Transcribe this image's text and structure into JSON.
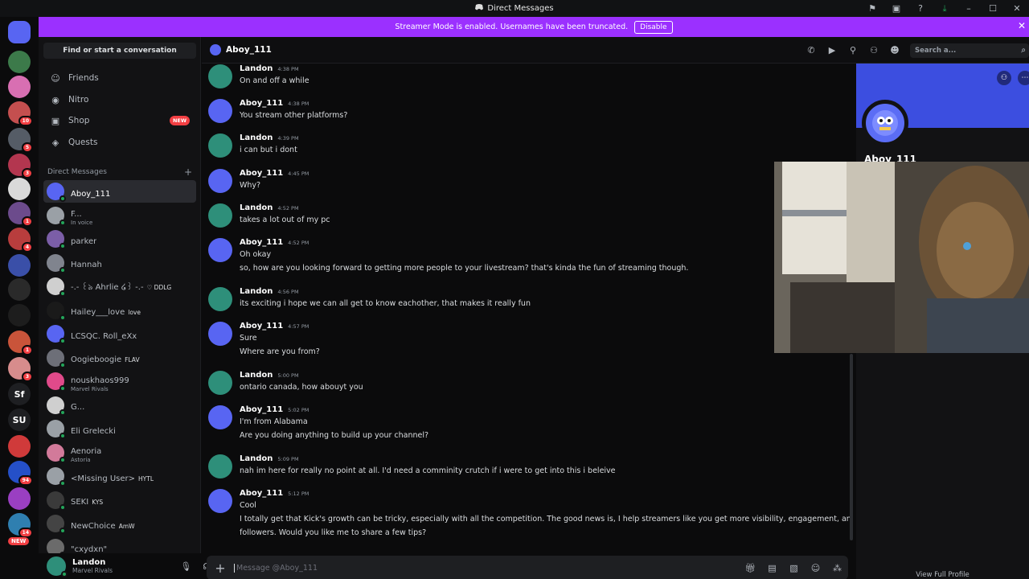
{
  "window": {
    "title": "Direct Messages"
  },
  "banner": {
    "text": "Streamer Mode is enabled. Usernames have been truncated.",
    "button": "Disable"
  },
  "servers": [
    {
      "label": "",
      "color": "#5865f2",
      "badge": ""
    },
    {
      "label": "",
      "color": "#3c7a4a",
      "badge": ""
    },
    {
      "label": "",
      "color": "#d86fb2",
      "badge": ""
    },
    {
      "label": "",
      "color": "#c44f4f",
      "badge": "10"
    },
    {
      "label": "",
      "color": "#555c66",
      "badge": "5"
    },
    {
      "label": "",
      "color": "#b3364f",
      "badge": "3"
    },
    {
      "label": "",
      "color": "#d9d9d9",
      "badge": ""
    },
    {
      "label": "",
      "color": "#6c4b8c",
      "badge": "1"
    },
    {
      "label": "",
      "color": "#b83d3d",
      "badge": "4"
    },
    {
      "label": "",
      "color": "#3a4fa8",
      "badge": ""
    },
    {
      "label": "",
      "color": "#2a2a2a",
      "badge": ""
    },
    {
      "label": "",
      "color": "#1d1d1d",
      "badge": ""
    },
    {
      "label": "",
      "color": "#c9543a",
      "badge": "1"
    },
    {
      "label": "",
      "color": "#d78c8c",
      "badge": "3"
    },
    {
      "label": "Sf",
      "color": "#1e1f22",
      "badge": ""
    },
    {
      "label": "SU",
      "color": "#1e1f22",
      "badge": ""
    },
    {
      "label": "",
      "color": "#d03a3a",
      "badge": ""
    },
    {
      "label": "",
      "color": "#2550c8",
      "badge": "94"
    },
    {
      "label": "",
      "color": "#9a3fc2",
      "badge": ""
    },
    {
      "label": "",
      "color": "#2f7fb0",
      "badge": "14"
    }
  ],
  "rail_new": "NEW",
  "dm_panel": {
    "find": "Find or start a conversation",
    "nav": [
      {
        "label": "Friends",
        "icon": "friends-icon"
      },
      {
        "label": "Nitro",
        "icon": "nitro-icon"
      },
      {
        "label": "Shop",
        "icon": "shop-icon",
        "badge": "NEW"
      },
      {
        "label": "Quests",
        "icon": "quests-icon"
      }
    ],
    "header": "Direct Messages",
    "items": [
      {
        "name": "Aboy_111",
        "sub": "",
        "tag": "",
        "color": "#5865f2",
        "active": true
      },
      {
        "name": "F...",
        "sub": "In voice",
        "tag": "",
        "color": "#9aa0a6",
        "active": false
      },
      {
        "name": "parker",
        "sub": "",
        "tag": "",
        "color": "#7b5ea7",
        "active": false
      },
      {
        "name": "Hannah",
        "sub": "",
        "tag": "",
        "color": "#80848e",
        "active": false
      },
      {
        "name": "-.- ꒰ঌ Ahrlie ໒꒱ -.-",
        "sub": "",
        "tag": "♡ DDLG",
        "color": "#cfcfcf",
        "active": false
      },
      {
        "name": "Hailey___love",
        "sub": "",
        "tag": "love",
        "color": "#1a1a1a",
        "active": false
      },
      {
        "name": "LCSQC. Roll_eXx",
        "sub": "",
        "tag": "",
        "color": "#5865f2",
        "active": false
      },
      {
        "name": "Oogieboogie",
        "sub": "",
        "tag": "FLAV",
        "color": "#6d6f78",
        "active": false
      },
      {
        "name": "nouskhaos999",
        "sub": "Marvel Rivals",
        "tag": "",
        "color": "#e04a8a",
        "active": false
      },
      {
        "name": "G...",
        "sub": "",
        "tag": "",
        "color": "#cfcfcf",
        "active": false
      },
      {
        "name": "Eli Grelecki",
        "sub": "",
        "tag": "",
        "color": "#9aa0a6",
        "active": false
      },
      {
        "name": "Aenoria",
        "sub": "Astoria",
        "tag": "",
        "color": "#d27a9a",
        "active": false
      },
      {
        "name": "<Missing User>",
        "sub": "",
        "tag": "HYTL",
        "color": "#9aa0a6",
        "active": false
      },
      {
        "name": "SEKI",
        "sub": "",
        "tag": "KYS",
        "color": "#3a3a3a",
        "active": false
      },
      {
        "name": "NewChoice",
        "sub": "",
        "tag": "AmW",
        "color": "#444",
        "active": false
      },
      {
        "name": "\"cxydxn\"",
        "sub": "",
        "tag": "",
        "color": "#6b6b6b",
        "active": false
      }
    ]
  },
  "user_panel": {
    "name": "Landon",
    "sub": "Marvel Rivals"
  },
  "chat": {
    "recipient": "Aboy_111",
    "search_placeholder": "Search a...",
    "composer_placeholder": "Message @Aboy_111",
    "messages": [
      {
        "author": "Landon",
        "time": "4:38 PM",
        "lines": [
          "On and off a while"
        ]
      },
      {
        "author": "Aboy_111",
        "time": "4:38 PM",
        "lines": [
          "You stream other platforms?"
        ]
      },
      {
        "author": "Landon",
        "time": "4:39 PM",
        "lines": [
          "i can but i dont"
        ]
      },
      {
        "author": "Aboy_111",
        "time": "4:45 PM",
        "lines": [
          "Why?"
        ]
      },
      {
        "author": "Landon",
        "time": "4:52 PM",
        "lines": [
          "takes a lot out of my pc"
        ]
      },
      {
        "author": "Aboy_111",
        "time": "4:52 PM",
        "lines": [
          "Oh okay",
          "so, how are you looking forward to getting more people to your livestream? that's kinda the fun of streaming though."
        ]
      },
      {
        "author": "Landon",
        "time": "4:56 PM",
        "lines": [
          "its exciting i hope we can all get to know eachother, that makes it really fun"
        ]
      },
      {
        "author": "Aboy_111",
        "time": "4:57 PM",
        "lines": [
          "Sure",
          "Where are you from?"
        ]
      },
      {
        "author": "Landon",
        "time": "5:00 PM",
        "lines": [
          "ontario canada, how abouyt you"
        ]
      },
      {
        "author": "Aboy_111",
        "time": "5:02 PM",
        "lines": [
          "I'm from Alabama",
          "Are you doing anything to build up your channel?"
        ]
      },
      {
        "author": "Landon",
        "time": "5:09 PM",
        "lines": [
          "nah im here for really no point at all. I'd need a comminity crutch if i were to get into this i beleive"
        ]
      },
      {
        "author": "Aboy_111",
        "time": "5:12 PM",
        "lines": [
          "Cool",
          "I totally get that Kick's growth can be tricky, especially with all the competition. The good news is, I help streamers like you get more visibility, engagement, and",
          "followers. Would you like me to share a few tips?"
        ]
      }
    ]
  },
  "profile": {
    "name": "Aboy_111",
    "view_full": "View Full Profile"
  },
  "colors": {
    "banner": "#9b30ff",
    "aboy_avatar": "#5865f2",
    "landon_avatar": "#2e8f7a"
  }
}
